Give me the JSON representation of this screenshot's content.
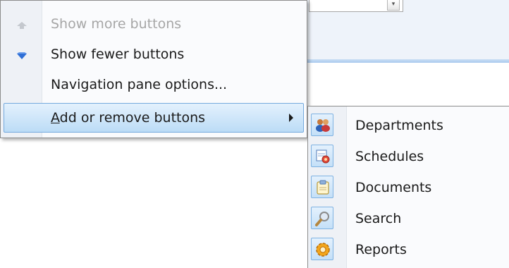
{
  "menu": {
    "items": [
      {
        "label": "Show more buttons",
        "icon": "arrow-up-icon",
        "state": "disabled"
      },
      {
        "label": "Show fewer buttons",
        "icon": "arrow-down-icon",
        "state": "enabled"
      },
      {
        "label": "Navigation pane options...",
        "state": "enabled"
      },
      {
        "label_accel": "A",
        "label_rest": "dd or remove buttons",
        "state": "highlighted",
        "has_submenu": true
      }
    ]
  },
  "submenu": {
    "items": [
      {
        "label": "Departments",
        "icon": "people-icon",
        "checked": true
      },
      {
        "label": "Schedules",
        "icon": "calendar-clock-icon",
        "checked": true
      },
      {
        "label": "Documents",
        "icon": "document-icon",
        "checked": true
      },
      {
        "label": "Search",
        "icon": "magnifier-icon",
        "checked": true
      },
      {
        "label": "Reports",
        "icon": "gear-report-icon",
        "checked": true
      }
    ]
  },
  "colors": {
    "highlight_fill": "#bcdcf6",
    "highlight_border": "#74a9dd",
    "disabled_text": "#a6a6a6",
    "arrow_blue": "#2f6fd6"
  }
}
